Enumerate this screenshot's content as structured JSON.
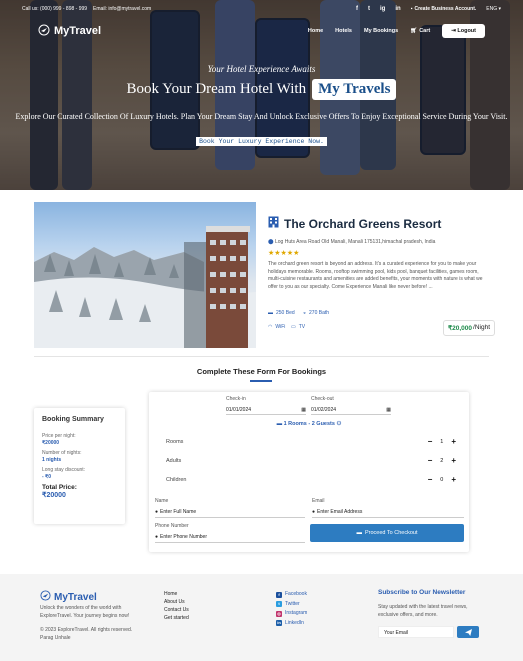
{
  "topbar": {
    "phone": "Call us: (000) 999 - 898 - 999",
    "email": "Email: info@mytravel.com",
    "social": [
      "f",
      "t",
      "ig",
      "in"
    ],
    "create_account": "Create Business Account.",
    "language": "ENG"
  },
  "nav": {
    "brand": "MyTravel",
    "links": [
      "Home",
      "Hotels",
      "My Bookings",
      "Cart"
    ],
    "logout": "Logout"
  },
  "hero": {
    "subtitle": "Your Hotel Experience Awaits",
    "title": "Book Your Dream Hotel With",
    "title_highlight": "My Travels",
    "description": "Explore Our Curated Collection Of Luxury Hotels. Plan Your Dream Stay And Unlock Exclusive Offers To Enjoy Exceptional Service During Your Visit.",
    "cta": "Book Your Luxury Experience Now."
  },
  "resort": {
    "name": "The Orchard Greens Resort",
    "address": "Log Huts Area Road Old Manali, Manali 175131,himachal pradesh, India",
    "stars": "★★★★★",
    "rating": 5,
    "description": "The orchard green resort is beyond an address. It's a curated experience for you to make your holidays memorable. Rooms, rooftop swimming pool, kids pool, banquet facilities, games room, multi-cuisine restaurants and amenities are added benefits, your moments with nature is what we offer to you as our specialty. Come Experience Manali like never before! ...",
    "beds": "250 Bed",
    "baths": "270 Bath",
    "wifi": "WiFi",
    "tv": "TV",
    "price": "₹20,000",
    "price_unit": "/Night"
  },
  "section_title": "Complete These Form For Bookings",
  "summary": {
    "title": "Booking Summary",
    "price_label": "Price per night:",
    "price_value": "₹20000",
    "nights_label": "Number of nights:",
    "nights_value": "1 nights",
    "discount_label": "Long stay discount:",
    "discount_value": "- ₹0",
    "total_label": "Total Price:",
    "total_value": "₹20000"
  },
  "form": {
    "checkin_label": "Check-in",
    "checkin_value": "01/01/2024",
    "checkout_label": "Check-out",
    "checkout_value": "01/02/2024",
    "rooms_guests": "1 Rooms - 2 Guests",
    "counters": [
      {
        "label": "Rooms",
        "value": "1"
      },
      {
        "label": "Adults",
        "value": "2"
      },
      {
        "label": "Children",
        "value": "0"
      }
    ],
    "name_label": "Name",
    "name_placeholder": "Enter Full Name",
    "email_label": "Email",
    "email_placeholder": "Enter Email Address",
    "phone_label": "Phone Number",
    "phone_placeholder": "Enter Phone Number",
    "submit": "Proceed To Checkout"
  },
  "footer": {
    "brand": "MyTravel",
    "tagline": "Unlock the wonders of the world with ExploreTravel. Your journey begins now!",
    "copyright": "© 2023 ExploreTravel. All rights reserved.",
    "author": "Parag Unhale",
    "links": [
      "Home",
      "About Us",
      "Contact Us",
      "Get started"
    ],
    "social": [
      "Facebook",
      "Twitter",
      "Instagram",
      "LinkedIn"
    ],
    "newsletter_title": "Subscribe to Our Newsletter",
    "newsletter_text": "Stay updated with the latest travel news, exclusive offers, and more.",
    "email_placeholder": "Your Email"
  },
  "colors": {
    "accent": "#2a5db0",
    "button": "#2d7cc1",
    "price": "#1d8a4a",
    "stars": "#e0a800"
  }
}
